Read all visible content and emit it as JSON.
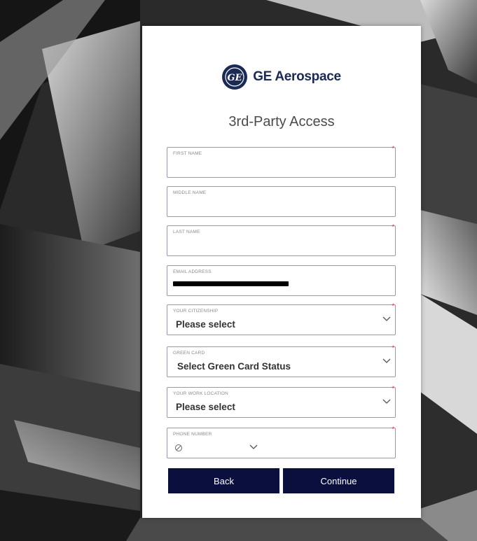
{
  "brand": {
    "name": "GE Aerospace",
    "monogram": "GE",
    "color": "#1b2a55"
  },
  "form": {
    "title": "3rd-Party Access",
    "required_marker": "*",
    "fields": {
      "first_name": {
        "label": "FIRST NAME",
        "value": ""
      },
      "middle_name": {
        "label": "MIDDLE NAME",
        "value": ""
      },
      "last_name": {
        "label": "LAST NAME",
        "value": ""
      },
      "email": {
        "label": "EMAIL ADDRESS"
      },
      "citizenship": {
        "label": "YOUR CITIZENSHIP",
        "value": "Please select"
      },
      "green_card": {
        "label": "GREEN CARD",
        "value": "Select Green Card Status"
      },
      "work_location": {
        "label": "YOUR WORK LOCATION",
        "value": "Please select"
      },
      "phone": {
        "label": "PHONE NUMBER",
        "country_icon": "no-flag-icon",
        "value": ""
      }
    },
    "buttons": {
      "back": "Back",
      "continue": "Continue"
    }
  },
  "colors": {
    "button_bg": "#0b0f3d",
    "required": "#e0293f"
  }
}
